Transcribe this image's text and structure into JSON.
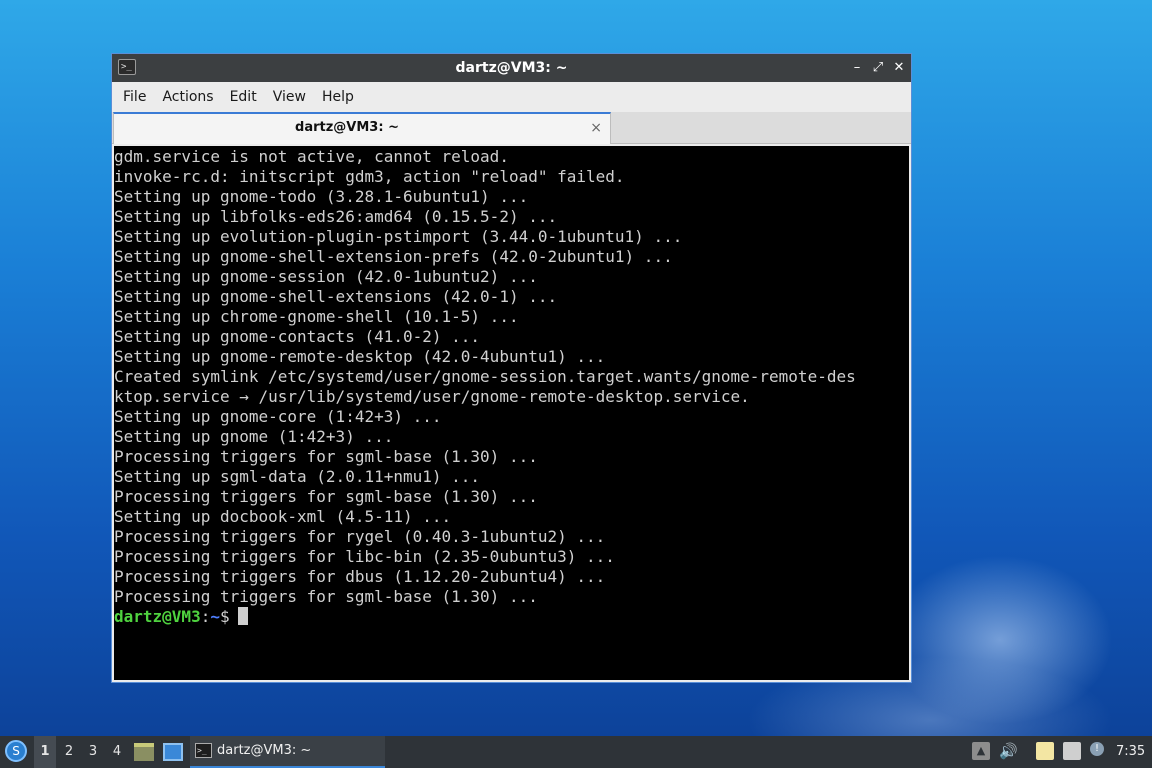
{
  "window": {
    "title": "dartz@VM3: ~",
    "app_icon": ">_",
    "controls": {
      "minimize": "–",
      "maximize": "⤢",
      "close": "✕"
    }
  },
  "menubar": {
    "items": [
      "File",
      "Actions",
      "Edit",
      "View",
      "Help"
    ]
  },
  "tab": {
    "label": "dartz@VM3: ~",
    "close": "×"
  },
  "terminal": {
    "lines": [
      "gdm.service is not active, cannot reload.",
      "invoke-rc.d: initscript gdm3, action \"reload\" failed.",
      "Setting up gnome-todo (3.28.1-6ubuntu1) ...",
      "Setting up libfolks-eds26:amd64 (0.15.5-2) ...",
      "Setting up evolution-plugin-pstimport (3.44.0-1ubuntu1) ...",
      "Setting up gnome-shell-extension-prefs (42.0-2ubuntu1) ...",
      "Setting up gnome-session (42.0-1ubuntu2) ...",
      "Setting up gnome-shell-extensions (42.0-1) ...",
      "Setting up chrome-gnome-shell (10.1-5) ...",
      "Setting up gnome-contacts (41.0-2) ...",
      "Setting up gnome-remote-desktop (42.0-4ubuntu1) ...",
      "Created symlink /etc/systemd/user/gnome-session.target.wants/gnome-remote-des",
      "ktop.service → /usr/lib/systemd/user/gnome-remote-desktop.service.",
      "Setting up gnome-core (1:42+3) ...",
      "Setting up gnome (1:42+3) ...",
      "Processing triggers for sgml-base (1.30) ...",
      "Setting up sgml-data (2.0.11+nmu1) ...",
      "Processing triggers for sgml-base (1.30) ...",
      "Setting up docbook-xml (4.5-11) ...",
      "Processing triggers for rygel (0.40.3-1ubuntu2) ...",
      "Processing triggers for libc-bin (2.35-0ubuntu3) ...",
      "Processing triggers for dbus (1.12.20-2ubuntu4) ...",
      "Processing triggers for sgml-base (1.30) ..."
    ],
    "prompt": {
      "user_host": "dartz@VM3",
      "separator": ":",
      "path": "~",
      "symbol": "$"
    }
  },
  "taskbar": {
    "start_icon": "S",
    "workspaces": [
      "1",
      "2",
      "3",
      "4"
    ],
    "active_workspace": "1",
    "task_label": "dartz@VM3: ~",
    "task_icon": ">_",
    "tray_volume": "🔊",
    "clock": "7:35"
  }
}
